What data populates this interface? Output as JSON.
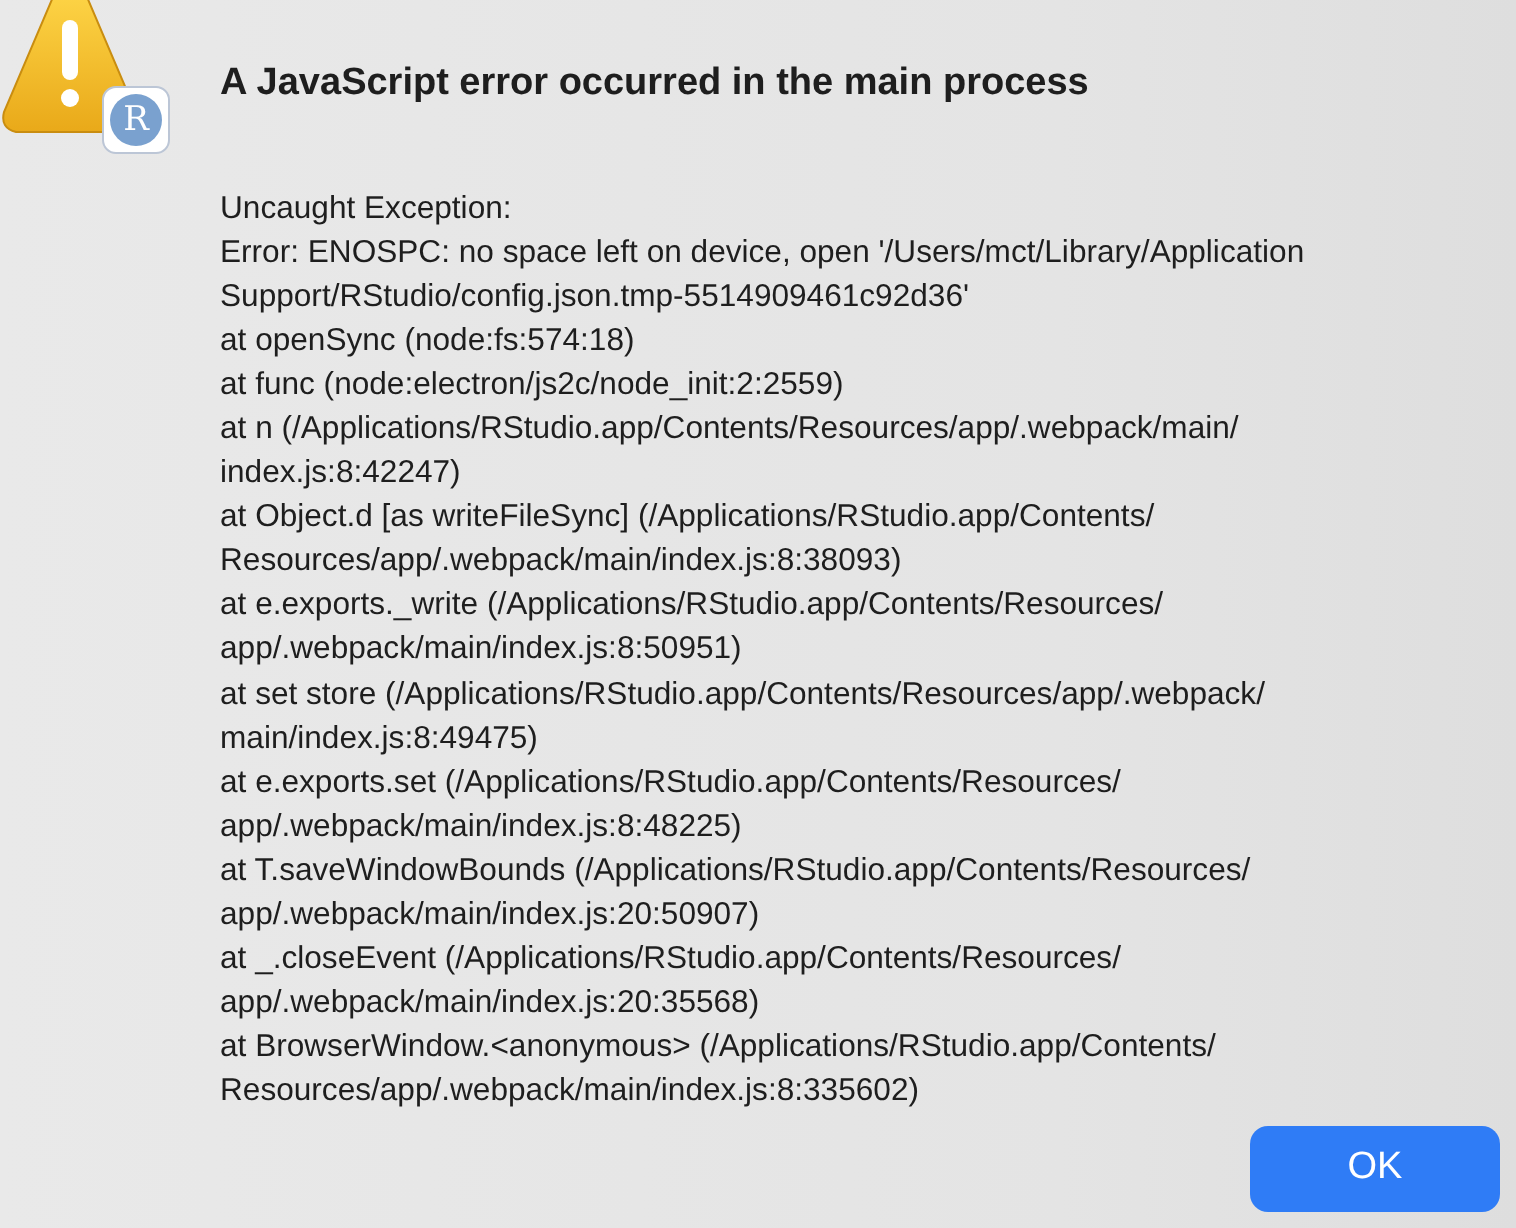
{
  "dialog": {
    "badge": "R",
    "title": "A JavaScript error occurred in the main process",
    "message_lines": [
      "Uncaught Exception:",
      "Error: ENOSPC: no space left on device, open '/Users/mct/Library/Application",
      "Support/RStudio/config.json.tmp-5514909461c92d36'",
      "at openSync (node:fs:574:18)",
      "at func (node:electron/js2c/node_init:2:2559)",
      "at n (/Applications/RStudio.app/Contents/Resources/app/.webpack/main/",
      "index.js:8:42247)",
      "at Object.d [as writeFileSync] (/Applications/RStudio.app/Contents/",
      "Resources/app/.webpack/main/index.js:8:38093)",
      "at e.exports._write (/Applications/RStudio.app/Contents/Resources/",
      "app/.webpack/main/index.js:8:50951)",
      "at set store (/Applications/RStudio.app/Contents/Resources/app/.webpack/",
      "main/index.js:8:49475)",
      "at e.exports.set (/Applications/RStudio.app/Contents/Resources/",
      "app/.webpack/main/index.js:8:48225)",
      "at T.saveWindowBounds (/Applications/RStudio.app/Contents/Resources/",
      "app/.webpack/main/index.js:20:50907)",
      "at _.closeEvent (/Applications/RStudio.app/Contents/Resources/",
      "app/.webpack/main/index.js:20:35568)",
      "at BrowserWindow.<anonymous> (/Applications/RStudio.app/Contents/",
      "Resources/app/.webpack/main/index.js:8:335602)"
    ],
    "buttons": [
      "OK"
    ]
  }
}
